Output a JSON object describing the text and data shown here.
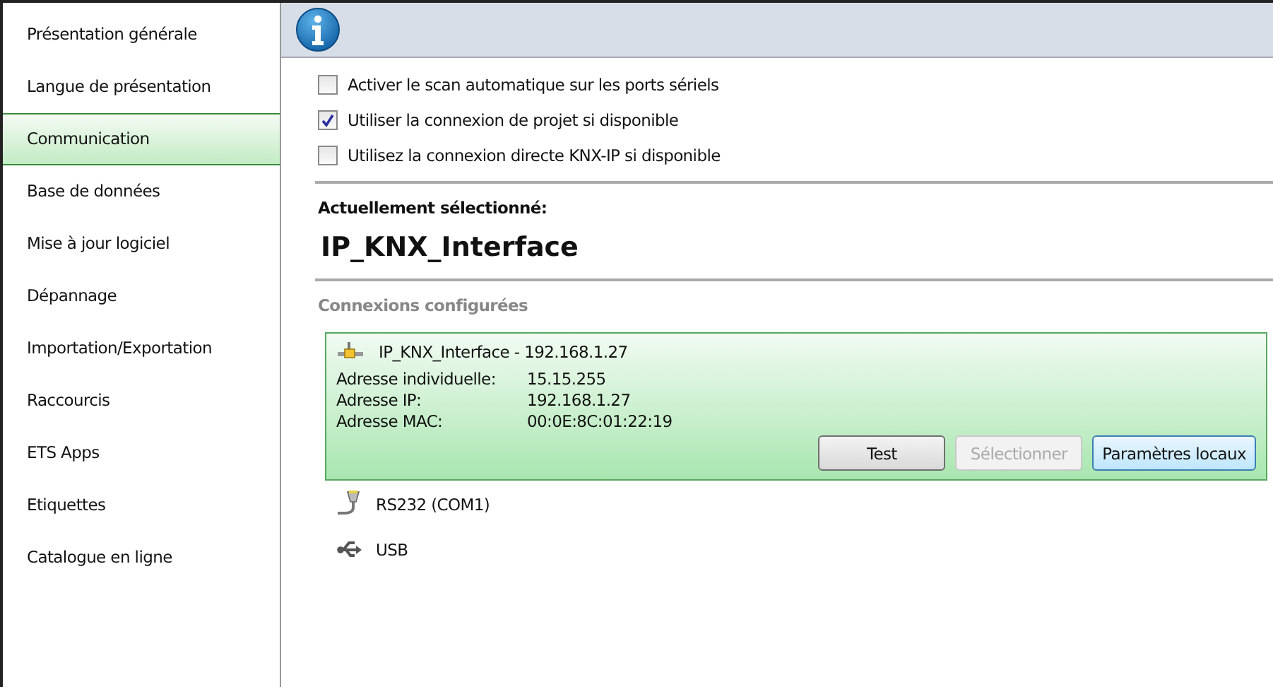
{
  "sidebar": {
    "items": [
      {
        "label": "Présentation générale",
        "selected": false
      },
      {
        "label": "Langue de présentation",
        "selected": false
      },
      {
        "label": "Communication",
        "selected": true
      },
      {
        "label": "Base de données",
        "selected": false
      },
      {
        "label": "Mise à jour logiciel",
        "selected": false
      },
      {
        "label": "Dépannage",
        "selected": false
      },
      {
        "label": "Importation/Exportation",
        "selected": false
      },
      {
        "label": "Raccourcis",
        "selected": false
      },
      {
        "label": "ETS Apps",
        "selected": false
      },
      {
        "label": "Etiquettes",
        "selected": false
      },
      {
        "label": "Catalogue en ligne",
        "selected": false
      }
    ]
  },
  "options": [
    {
      "label": "Activer le scan automatique sur les ports sériels",
      "checked": false
    },
    {
      "label": "Utiliser la connexion de projet si disponible",
      "checked": true
    },
    {
      "label": "Utilisez la connexion directe KNX-IP si disponible",
      "checked": false
    }
  ],
  "current": {
    "heading": "Actuellement sélectionné:",
    "name": "IP_KNX_Interface"
  },
  "configured": {
    "heading": "Connexions configurées",
    "connections": [
      {
        "kind": "ip",
        "title": "IP_KNX_Interface - 192.168.1.27",
        "selected": true,
        "details": [
          {
            "label": "Adresse individuelle:",
            "value": "15.15.255"
          },
          {
            "label": "Adresse IP:",
            "value": "192.168.1.27"
          },
          {
            "label": "Adresse MAC:",
            "value": "00:0E:8C:01:22:19"
          }
        ],
        "buttons": [
          {
            "label": "Test",
            "disabled": false,
            "focused": false
          },
          {
            "label": "Sélectionner",
            "disabled": true,
            "focused": false
          },
          {
            "label": "Paramètres locaux",
            "disabled": false,
            "focused": true
          }
        ]
      },
      {
        "kind": "serial",
        "title": "RS232 (COM1)",
        "selected": false
      },
      {
        "kind": "usb",
        "title": "USB",
        "selected": false
      }
    ]
  }
}
